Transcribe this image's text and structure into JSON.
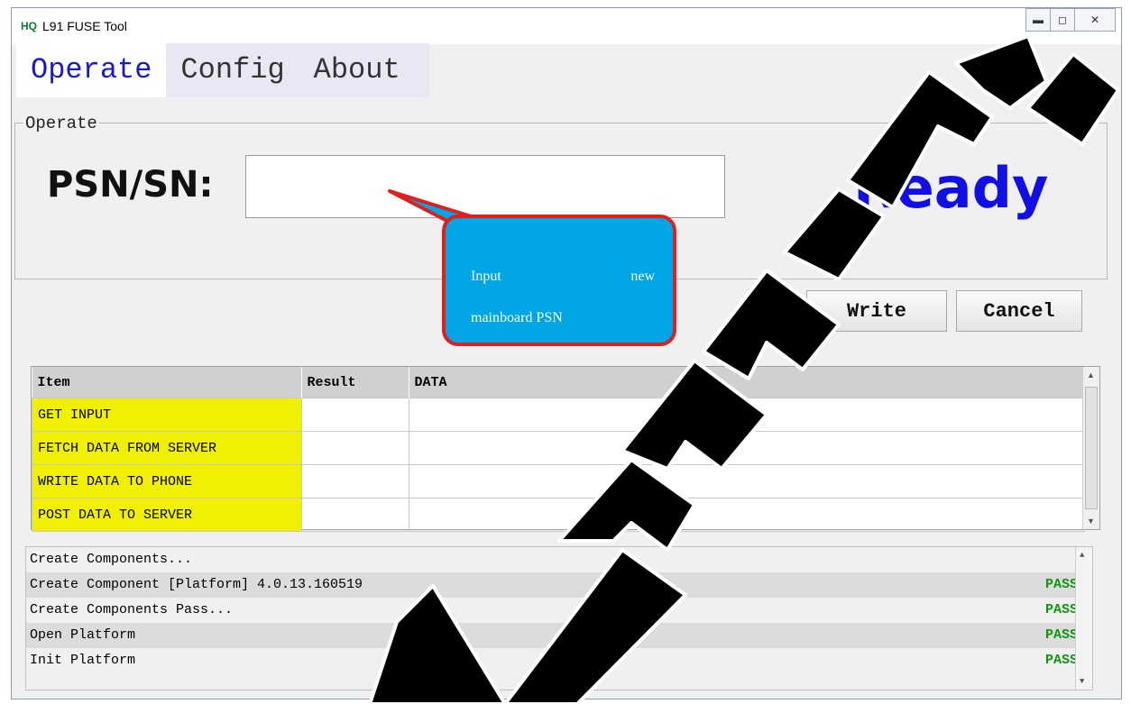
{
  "window": {
    "logo": "HQ",
    "title": "L91 FUSE Tool",
    "controls": {
      "minimize": "minimize-icon",
      "maximize": "maximize-icon",
      "close": "close-icon"
    }
  },
  "tabs": [
    {
      "label": "Operate",
      "active": true
    },
    {
      "label": "Config",
      "active": false
    },
    {
      "label": "About",
      "active": false
    }
  ],
  "operate": {
    "group_label": "Operate",
    "psn_label": "PSN/SN:",
    "psn_value": "",
    "status": "Ready",
    "write_label": "Write",
    "cancel_label": "Cancel"
  },
  "callout": {
    "line1_a": "Input",
    "line1_b": "new",
    "line2": "mainboard PSN"
  },
  "grid": {
    "columns": [
      "Item",
      "Result",
      "DATA"
    ],
    "rows": [
      {
        "item": "GET INPUT",
        "result": "",
        "data": ""
      },
      {
        "item": "FETCH DATA FROM SERVER",
        "result": "",
        "data": ""
      },
      {
        "item": "WRITE DATA TO PHONE",
        "result": "",
        "data": ""
      },
      {
        "item": "POST DATA TO SERVER",
        "result": "",
        "data": ""
      }
    ]
  },
  "log": [
    {
      "text": "Create Components...",
      "result": ""
    },
    {
      "text": "Create Component [Platform] 4.0.13.160519",
      "result": "PASS"
    },
    {
      "text": "Create Components Pass...",
      "result": "PASS"
    },
    {
      "text": "Open Platform",
      "result": "PASS"
    },
    {
      "text": "Init Platform",
      "result": "PASS"
    }
  ],
  "colors": {
    "status": "#1010e6",
    "item_highlight": "#f0f000",
    "pass": "#129612",
    "callout_fill": "#00a6e6",
    "callout_border": "#e02020",
    "active_tab": "#1a1acd"
  }
}
